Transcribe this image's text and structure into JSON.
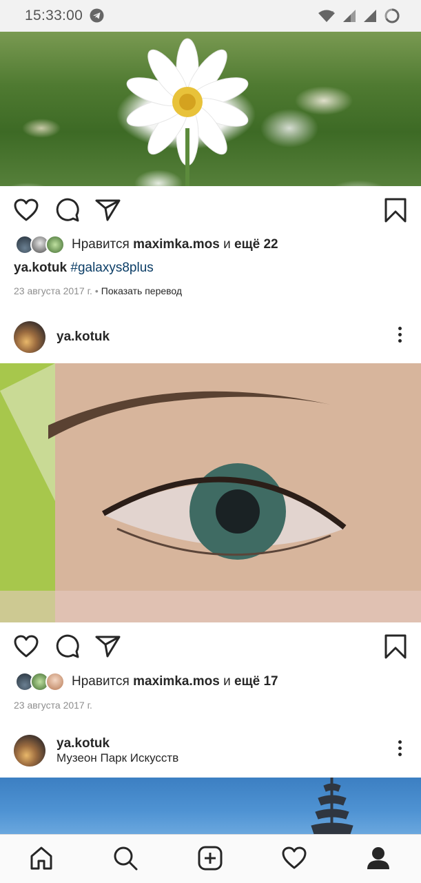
{
  "status_bar": {
    "time": "15:33:00",
    "icons": [
      "telegram-icon",
      "wifi-icon",
      "signal-icon",
      "signal-icon",
      "battery-loading-icon"
    ]
  },
  "posts": [
    {
      "photo": "flower-photo",
      "likes": {
        "prefix": "Нравится",
        "user": "maximka.mos",
        "joiner": "и",
        "more": "ещё 22"
      },
      "caption": {
        "user": "ya.kotuk",
        "hashtag": "#galaxys8plus"
      },
      "date": "23 августа 2017 г.",
      "separator": "•",
      "translate": "Показать перевод"
    },
    {
      "header": {
        "user": "ya.kotuk"
      },
      "photo": "eye-photo",
      "likes": {
        "prefix": "Нравится",
        "user": "maximka.mos",
        "joiner": "и",
        "more": "ещё 17"
      },
      "date": "23 августа 2017 г."
    },
    {
      "header": {
        "user": "ya.kotuk",
        "location": "Музеон Парк Искусств"
      },
      "photo": "ship-photo"
    }
  ],
  "bottom_nav": [
    "home-icon",
    "search-icon",
    "add-post-icon",
    "activity-heart-icon",
    "profile-icon"
  ]
}
